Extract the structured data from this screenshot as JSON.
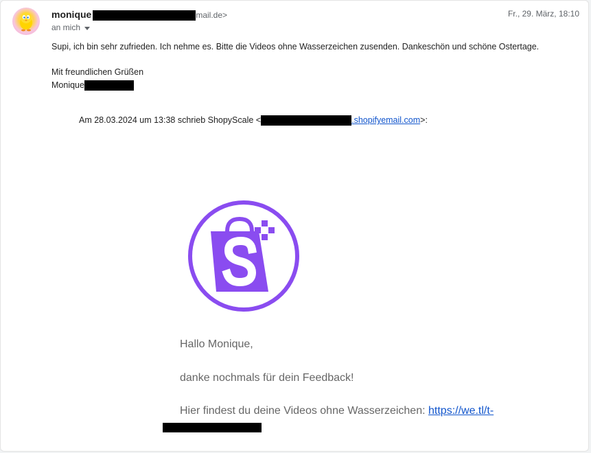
{
  "header": {
    "sender_name": "monique",
    "sender_email_suffix": "mail.de>",
    "date": "Fr., 29. März, 18:10",
    "to_label": "an mich"
  },
  "message": {
    "line1": "Supi, ich bin sehr zufrieden. Ich nehme es. Bitte die Videos ohne Wasserzeichen zusenden. Dankeschön und schöne Ostertage.",
    "greeting": "Mit freundlichen Grüßen",
    "signature": "Monique"
  },
  "quote": {
    "intro": "Am 28.03.2024 um 13:38 schrieb ShopyScale <",
    "email_suffix": ".shopifyemail.com",
    "outro": ">:"
  },
  "quoted_email": {
    "hello": "Hallo Monique,",
    "thanks": "danke nochmals für dein Feedback!",
    "videos_text": "Hier findest du deine Videos ohne Wasserzeichen: ",
    "videos_link": "https://we.tl/t-"
  },
  "colors": {
    "logo_purple": "#8a4cf0",
    "link_blue": "#1155cc"
  }
}
